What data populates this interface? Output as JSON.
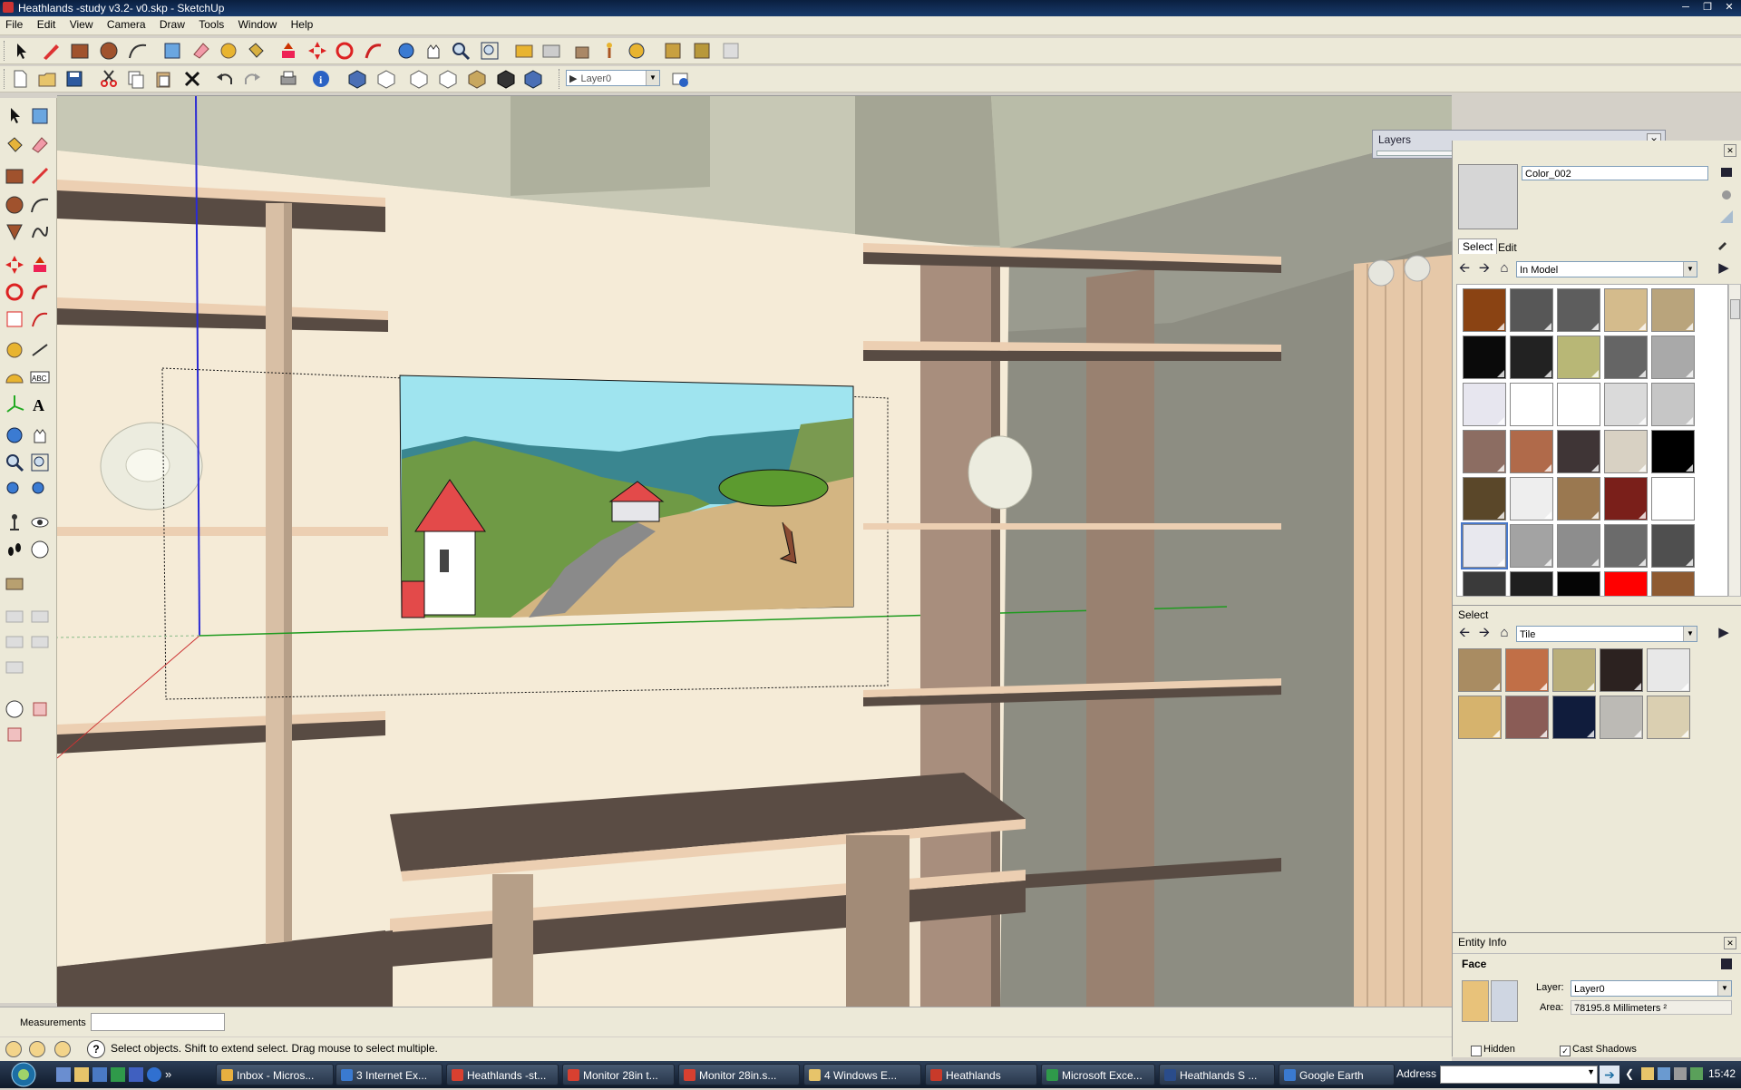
{
  "window": {
    "title": "Heathlands -study v3.2- v0.skp - SketchUp",
    "controls": [
      "minimize",
      "restore",
      "close"
    ]
  },
  "menu": [
    "File",
    "Edit",
    "View",
    "Camera",
    "Draw",
    "Tools",
    "Window",
    "Help"
  ],
  "toolbar": {
    "layer_select": "Layer0"
  },
  "layers_window": {
    "title": "Layers"
  },
  "materials": {
    "name_value": "Color_002",
    "tabs": [
      "Select",
      "Edit"
    ],
    "library_top": "In Model",
    "top_swatches": [
      "#8a4313",
      "#575757",
      "#5d5d5d",
      "#d4bb8c",
      "#b9a47c",
      "#0a0a0a",
      "#222222",
      "#b8b776",
      "#656565",
      "#a9a9a9",
      "#e7e6ef",
      "#ffffff",
      "#ffffff",
      "#dadada",
      "#c6c6c6",
      "#8c6d62",
      "#b06a4a",
      "#3f3536",
      "#d8d1c3",
      "#000000",
      "#5a4729",
      "#eeeeee",
      "#9a7850",
      "#7a1f1a",
      "#ffffff",
      "#e8e8ee",
      "#a3a3a3",
      "#8d8d8d",
      "#6b6b6b",
      "#4f4f4f",
      "#3a3a3a",
      "#1f1f1f",
      "#050505",
      "#ff0000",
      "#8e5a31"
    ],
    "select_label": "Select",
    "library_bottom": "Tile",
    "bottom_swatches": [
      "#a98c62",
      "#c16f47",
      "#b9ae7a",
      "#2c2220",
      "#e8e8e8",
      "#d6b36d",
      "#8a5c56",
      "#101c3c",
      "#bcbab5",
      "#dacfb1"
    ],
    "bottom_icon": "tile-icon"
  },
  "entity_info": {
    "title": "Entity Info",
    "type": "Face",
    "layer_label": "Layer:",
    "layer_value": "Layer0",
    "area_label": "Area:",
    "area_value": "78195.8 Millimeters ²",
    "hidden_label": "Hidden",
    "cast_shadows_label": "Cast Shadows",
    "hidden_checked": false,
    "cast_shadows_checked": true
  },
  "measurements": {
    "label": "Measurements",
    "value": ""
  },
  "status": {
    "hint": "Select objects. Shift to extend select. Drag mouse to select multiple."
  },
  "taskbar": {
    "items": [
      "Inbox - Micros...",
      "3 Internet Ex...",
      "Heathlands -st...",
      "Monitor 28in t...",
      "Monitor 28in.s...",
      "4 Windows E...",
      "Heathlands",
      "Microsoft Exce...",
      "Heathlands S ...",
      "Google Earth"
    ],
    "address_label": "Address",
    "clock": "15:42"
  }
}
